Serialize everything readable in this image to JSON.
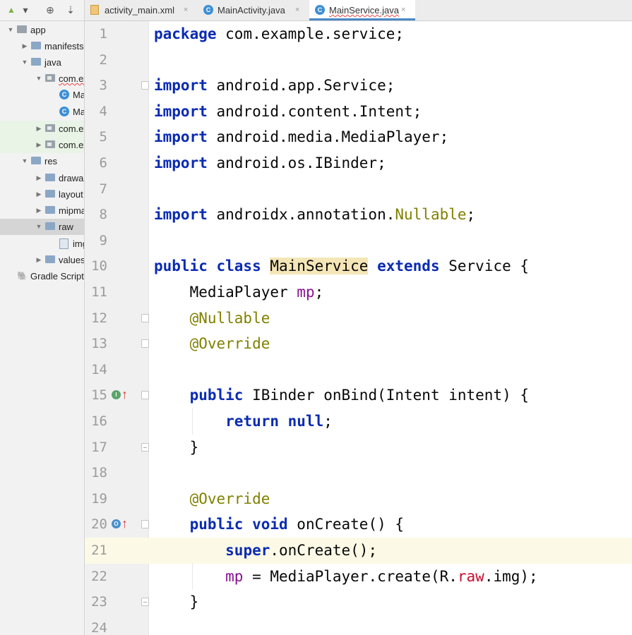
{
  "project_panel": {
    "toolbar": {
      "view_icon": "android-icon",
      "dropdown_glyph": "▾",
      "locate_glyph": "⊕",
      "settings_glyph": "⇣"
    },
    "tree": [
      {
        "label": "app",
        "icon": "module-icon",
        "expanded": true
      },
      {
        "label": "manifests",
        "icon": "folder-icon",
        "expanded": false
      },
      {
        "label": "java",
        "icon": "folder-icon",
        "expanded": true
      },
      {
        "label": "com.ex",
        "icon": "package-icon",
        "expanded": true
      },
      {
        "label": "Mai",
        "icon": "class-icon"
      },
      {
        "label": "Mai",
        "icon": "class-icon"
      },
      {
        "label": "com.ex",
        "icon": "package-icon",
        "expanded": false
      },
      {
        "label": "com.ex",
        "icon": "package-icon",
        "expanded": false
      },
      {
        "label": "res",
        "icon": "folder-icon",
        "expanded": true
      },
      {
        "label": "drawabl",
        "icon": "folder-icon",
        "expanded": false
      },
      {
        "label": "layout",
        "icon": "folder-icon",
        "expanded": false
      },
      {
        "label": "mipmap",
        "icon": "folder-icon",
        "expanded": false
      },
      {
        "label": "raw",
        "icon": "folder-icon",
        "expanded": true
      },
      {
        "label": "img",
        "icon": "file-icon"
      },
      {
        "label": "values",
        "icon": "folder-icon",
        "expanded": false
      },
      {
        "label": "Gradle Scripts",
        "icon": "gradle-icon"
      }
    ]
  },
  "tabs": [
    {
      "label": "activity_main.xml",
      "icon": "xml-file-icon",
      "close": "×",
      "active": false
    },
    {
      "label": "MainActivity.java",
      "icon": "class-icon",
      "close": "×",
      "active": false
    },
    {
      "label": "MainService.java",
      "icon": "class-icon",
      "close": "×",
      "active": true
    }
  ],
  "editor": {
    "current_line": 21,
    "lines": [
      {
        "n": "1",
        "code": [
          [
            "kw",
            "package"
          ],
          [
            "t",
            " com.example.service;"
          ]
        ]
      },
      {
        "n": "2",
        "code": []
      },
      {
        "n": "3",
        "code": [
          [
            "kw",
            "import"
          ],
          [
            "t",
            " android.app.Service;"
          ]
        ]
      },
      {
        "n": "4",
        "code": [
          [
            "kw",
            "import"
          ],
          [
            "t",
            " android.content.Intent;"
          ]
        ]
      },
      {
        "n": "5",
        "code": [
          [
            "kw",
            "import"
          ],
          [
            "t",
            " android.media.MediaPlayer;"
          ]
        ]
      },
      {
        "n": "6",
        "code": [
          [
            "kw",
            "import"
          ],
          [
            "t",
            " android.os.IBinder;"
          ]
        ]
      },
      {
        "n": "7",
        "code": []
      },
      {
        "n": "8",
        "code": [
          [
            "kw",
            "import"
          ],
          [
            "t",
            " androidx.annotation."
          ],
          [
            "ann",
            "Nullable"
          ],
          [
            "t",
            ";"
          ]
        ]
      },
      {
        "n": "9",
        "code": []
      },
      {
        "n": "10",
        "code": [
          [
            "kw",
            "public class "
          ],
          [
            "hl",
            "MainService"
          ],
          [
            "kw",
            " extends"
          ],
          [
            "t",
            " Service {"
          ]
        ]
      },
      {
        "n": "11",
        "code": [
          [
            "t",
            "    MediaPlayer "
          ],
          [
            "fld",
            "mp"
          ],
          [
            "t",
            ";"
          ]
        ]
      },
      {
        "n": "12",
        "code": [
          [
            "t",
            "    "
          ],
          [
            "ann",
            "@Nullable"
          ]
        ]
      },
      {
        "n": "13",
        "code": [
          [
            "t",
            "    "
          ],
          [
            "ann",
            "@Override"
          ]
        ]
      },
      {
        "n": "14",
        "code": []
      },
      {
        "n": "15",
        "code": [
          [
            "t",
            "    "
          ],
          [
            "kw",
            "public"
          ],
          [
            "t",
            " IBinder onBind(Intent intent) {"
          ]
        ]
      },
      {
        "n": "16",
        "code": [
          [
            "t",
            "        "
          ],
          [
            "kw",
            "return null"
          ],
          [
            "t",
            ";"
          ]
        ]
      },
      {
        "n": "17",
        "code": [
          [
            "t",
            "    }"
          ]
        ]
      },
      {
        "n": "18",
        "code": []
      },
      {
        "n": "19",
        "code": [
          [
            "t",
            "    "
          ],
          [
            "ann",
            "@Override"
          ]
        ]
      },
      {
        "n": "20",
        "code": [
          [
            "t",
            "    "
          ],
          [
            "kw",
            "public void"
          ],
          [
            "t",
            " onCreate() {"
          ]
        ]
      },
      {
        "n": "21",
        "code": [
          [
            "t",
            "        "
          ],
          [
            "kw",
            "super"
          ],
          [
            "t",
            ".onCreate();"
          ]
        ]
      },
      {
        "n": "22",
        "code": [
          [
            "t",
            "        "
          ],
          [
            "fld",
            "mp"
          ],
          [
            "t",
            " = MediaPlayer.create(R."
          ],
          [
            "fld2",
            "raw"
          ],
          [
            "t",
            ".img);"
          ]
        ]
      },
      {
        "n": "23",
        "code": [
          [
            "t",
            "    }"
          ]
        ]
      },
      {
        "n": "24",
        "code": []
      }
    ],
    "gutter_marks": [
      {
        "line": 15,
        "icon": "implements-icon",
        "glyph": "I",
        "arrow": "↑"
      },
      {
        "line": 20,
        "icon": "overrides-icon",
        "glyph": "O",
        "arrow": "↑"
      }
    ],
    "fold_markers": [
      3,
      12,
      13,
      15,
      17,
      20,
      23
    ]
  }
}
